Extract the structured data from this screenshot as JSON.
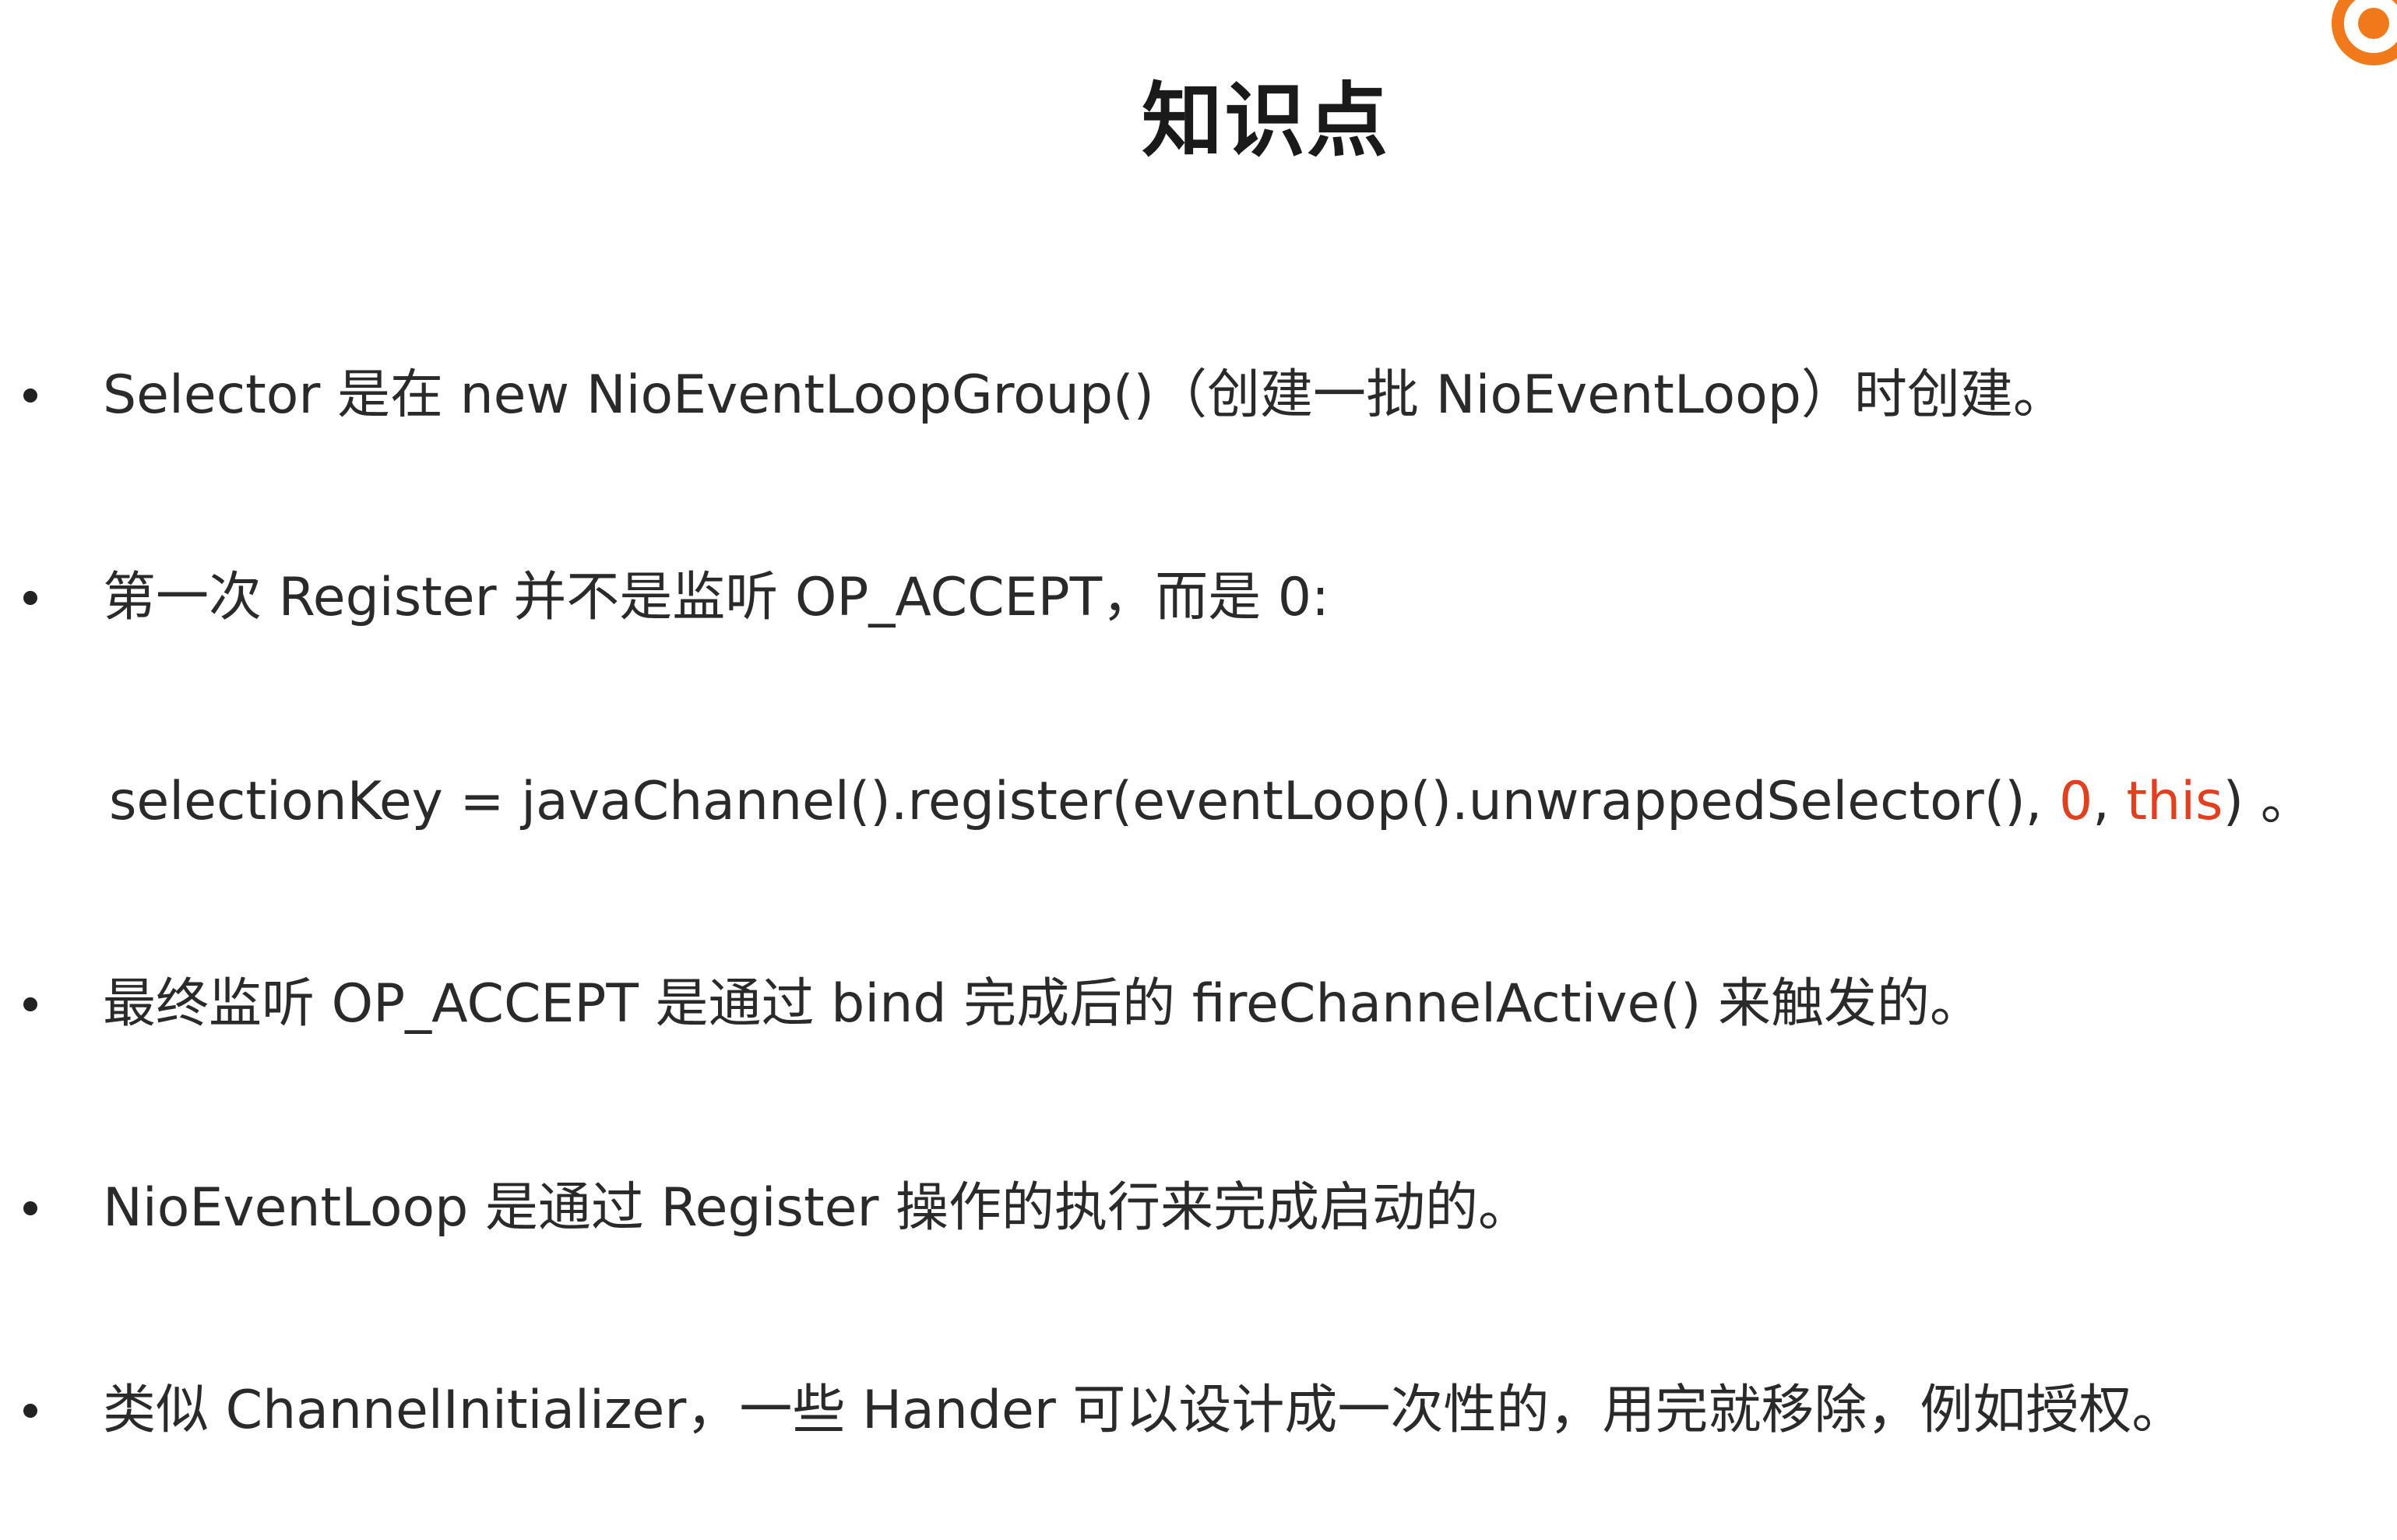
{
  "slide": {
    "title": "知识点",
    "bullets": [
      "Selector 是在 new NioEventLoopGroup()（创建一批 NioEventLoop）时创建。",
      "第一次 Register 并不是监听 OP_ACCEPT，而是 0:",
      "最终监听 OP_ACCEPT 是通过 bind 完成后的 fireChannelActive() 来触发的。",
      "NioEventLoop 是通过 Register 操作的执行来完成启动的。",
      "类似 ChannelInitializer，一些 Hander 可以设计成一次性的，用完就移除，例如授权。"
    ],
    "code_line": {
      "prefix": "selectionKey = javaChannel().register(eventLoop().unwrappedSelector(), ",
      "zero": "0",
      "comma": ", ",
      "this_kw": "this",
      "suffix": ") 。"
    },
    "colors": {
      "highlight": "#e0401f",
      "logo": "#f07a1a"
    },
    "logo_icon": "logo-icon"
  }
}
